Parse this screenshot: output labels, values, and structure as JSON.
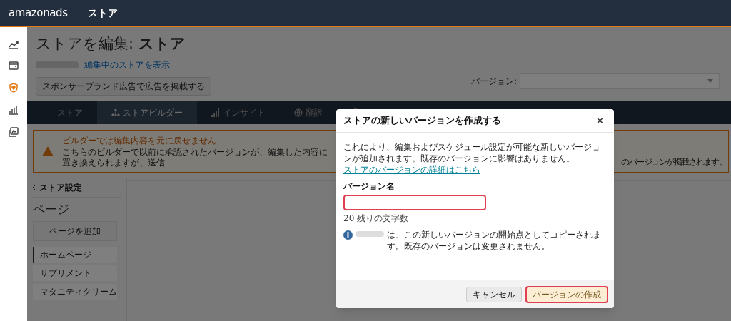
{
  "header": {
    "logo": "amazonads",
    "title": "ストア"
  },
  "rail": [
    {
      "kind": "trend",
      "selected": false
    },
    {
      "kind": "wallet",
      "selected": false
    },
    {
      "kind": "shield",
      "selected": true
    },
    {
      "kind": "bars",
      "selected": false
    },
    {
      "kind": "media",
      "selected": false
    }
  ],
  "page": {
    "title": "ストアを編集: **ストア**",
    "view_link": "編集中のストアを表示",
    "sponsor_button": "スポンサーブランド広告で広告を掲載する",
    "version_label": "バージョン:"
  },
  "tabs": [
    {
      "label": "ストア",
      "selected": false
    },
    {
      "label": "ストアビルダー",
      "selected": true
    },
    {
      "label": "インサイト",
      "selected": false
    },
    {
      "label": "翻訳",
      "selected": false
    },
    {
      "selected": false
    }
  ],
  "warning": {
    "title": "ビルダーでは編集内容を元に戻せません",
    "text": "こちらのビルダーで以前に承認されたバージョンが、編集した内容に置き換えられますが、送信",
    "text_end": "のバージョンが掲載されます。"
  },
  "left_panel": {
    "back": "ストア設定",
    "heading": "ページ",
    "add_button": "ページを追加",
    "pages": [
      {
        "label": "ホームページ",
        "selected": true
      },
      {
        "label": "サプリメント",
        "selected": false
      },
      {
        "label": "マタニティクリーム",
        "selected": false
      }
    ]
  },
  "modal": {
    "title": "ストアの新しいバージョンを作成する",
    "close": "×",
    "description": "これにより、編集およびスケジュール設定が可能な新しいバージョンが追加されます。既存のバージョンに影響はありません。",
    "link": "ストアのバージョンの詳細はこちら",
    "field_label": "バージョン名",
    "counter": "20 残りの文字数",
    "info_icon": "i",
    "info": "は、この新しいバージョンの開始点としてコピーされます。既存のバージョンは変更されません。",
    "cancel": "キャンセル",
    "create": "バージョンの作成",
    "create_disabled": true
  }
}
